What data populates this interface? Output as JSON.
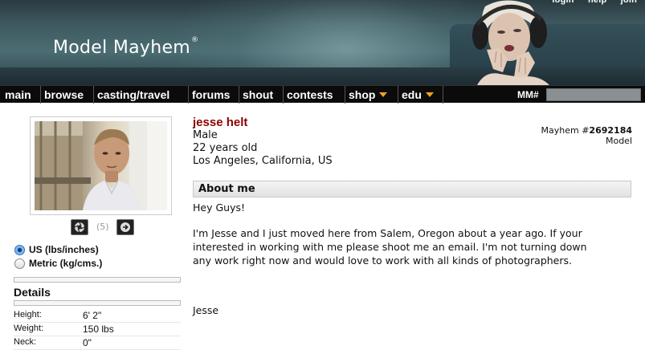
{
  "header": {
    "logo_text": "Model Mayhem",
    "logo_mark": "®",
    "top_links": [
      "login",
      "help",
      "join"
    ]
  },
  "nav": {
    "items": [
      {
        "label": "main",
        "dropdown": false
      },
      {
        "label": "browse",
        "dropdown": false
      },
      {
        "label": "casting/travel",
        "dropdown": false
      },
      {
        "label": "forums",
        "dropdown": false
      },
      {
        "label": "shout",
        "dropdown": false
      },
      {
        "label": "contests",
        "dropdown": false
      },
      {
        "label": "shop",
        "dropdown": true
      },
      {
        "label": "edu",
        "dropdown": true
      }
    ],
    "mm_label": "MM#",
    "mm_input_value": ""
  },
  "photo": {
    "count_text": "(5)",
    "prev_icon": "aperture-icon",
    "next_icon": "arrow-right-icon"
  },
  "units": {
    "us_label": "US (lbs/inches)",
    "metric_label": "Metric (kg/cms.)",
    "selected": "us"
  },
  "details": {
    "title": "Details",
    "rows": [
      {
        "label": "Height:",
        "value": "6' 2\""
      },
      {
        "label": "Weight:",
        "value": "150 lbs"
      },
      {
        "label": "Neck:",
        "value": "0\""
      }
    ]
  },
  "profile": {
    "name": "jesse helt",
    "gender": "Male",
    "age": "22 years old",
    "location": "Los Angeles, California, US",
    "mayhem_prefix": "Mayhem #",
    "mayhem_number": "2692184",
    "role": "Model"
  },
  "about": {
    "title": "About me",
    "greeting": "Hey Guys!",
    "body_line1": "I'm Jesse and I just moved here from Salem, Oregon about a year ago. If your",
    "body_line2": "interested in working with me please shoot me an email. I'm not turning down",
    "body_line3": "any work right now and would love to work with all kinds of photographers.",
    "signature": "Jesse"
  },
  "colors": {
    "nav_bg": "#0b0b0b",
    "caret": "#f0a020",
    "name": "#8b0000"
  }
}
